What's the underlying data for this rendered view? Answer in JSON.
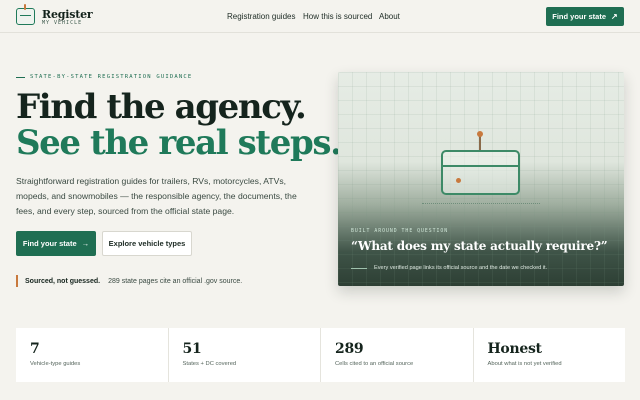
{
  "nav": {
    "logo_title": "Register",
    "logo_sub": "MY VEHICLE",
    "links": [
      "Registration guides",
      "How this is sourced",
      "About"
    ],
    "cta_label": "Find your state",
    "cta_icon": "arrow-up-right-icon"
  },
  "hero": {
    "eyebrow": "STATE-BY-STATE REGISTRATION GUIDANCE",
    "title_line1": "Find the agency.",
    "title_line2": "See the real steps.",
    "lede": "Straightforward registration guides for trailers, RVs, motorcycles, ATVs, mopeds, and snowmobiles — the responsible agency, the documents, the fees, and every step, sourced from the official state page.",
    "primary_button": "Find your state",
    "secondary_button": "Explore vehicle types",
    "sourced_label": "Sourced, not guessed.",
    "sourced_text": "289 state pages cite an official .gov source."
  },
  "card": {
    "eyebrow": "BUILT AROUND THE QUESTION",
    "quote": "“What does my state actually require?”",
    "note": "Every verified page links its official source and the date we checked it."
  },
  "stats": [
    {
      "value": "7",
      "label": "Vehicle-type guides"
    },
    {
      "value": "51",
      "label": "States + DC covered"
    },
    {
      "value": "289",
      "label": "Cells cited to an official source"
    },
    {
      "value": "Honest",
      "label": "About what is not yet verified"
    }
  ],
  "colors": {
    "brand_green": "#1f6e52",
    "accent_orange": "#c8793d",
    "background": "#f4f3ee"
  }
}
